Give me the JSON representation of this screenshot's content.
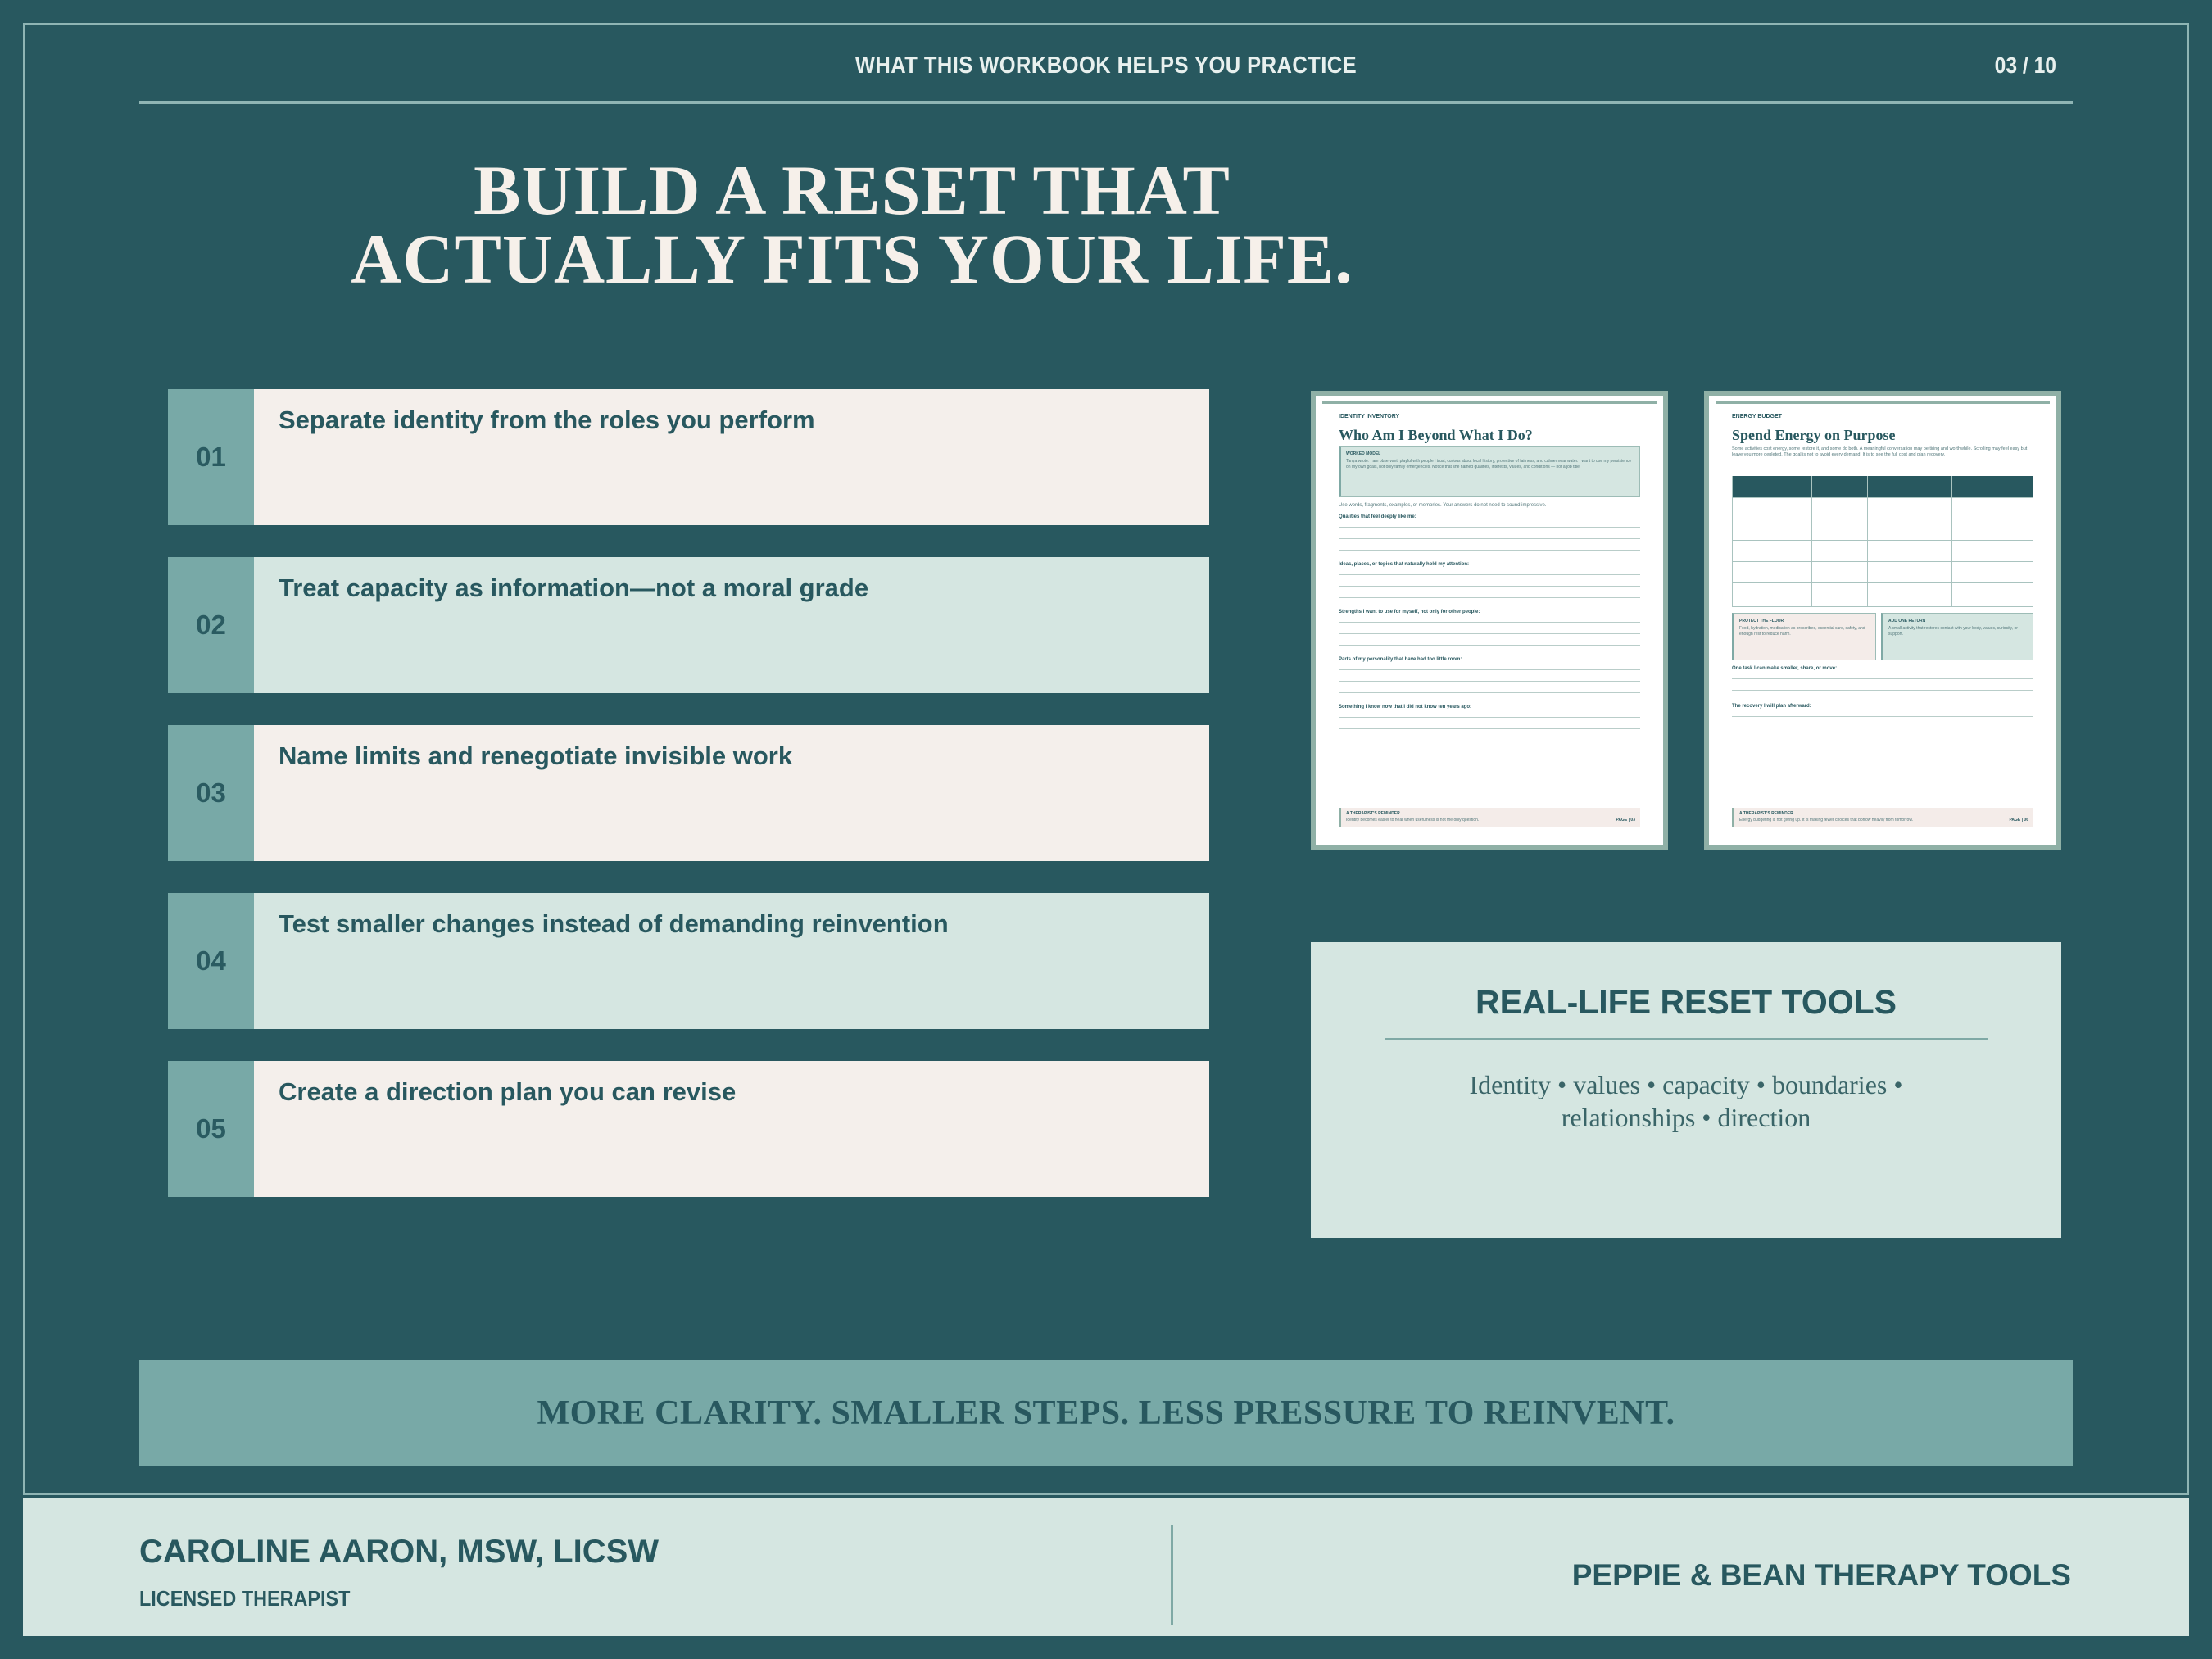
{
  "header": {
    "title": "WHAT THIS WORKBOOK HELPS YOU PRACTICE",
    "page": "03 / 10"
  },
  "headline": {
    "line1": "BUILD A RESET THAT",
    "line2": "ACTUALLY FITS YOUR LIFE."
  },
  "steps": [
    {
      "num": "01",
      "text": "Separate identity from the roles you perform"
    },
    {
      "num": "02",
      "text": "Treat capacity as information—not a moral grade"
    },
    {
      "num": "03",
      "text": "Name limits and renegotiate invisible work"
    },
    {
      "num": "04",
      "text": "Test smaller changes instead of demanding reinvention"
    },
    {
      "num": "05",
      "text": "Create a direction plan you can revise"
    }
  ],
  "previews": [
    {
      "kicker": "IDENTITY INVENTORY",
      "title": "Who Am I Beyond What I Do?",
      "box_label": "WORKED MODEL",
      "box_text": "Tanya wrote: I am observant, playful with people I trust, curious about local history, protective of fairness, and calmer near water. I want to use my persistence on my own goals, not only family emergencies. Notice that she named qualities, interests, values, and conditions — not a job title.",
      "intro": "Use words, fragments, examples, or memories. Your answers do not need to sound impressive.",
      "prompts": [
        "Qualities that feel deeply like me:",
        "Ideas, places, or topics that naturally hold my attention:",
        "Strengths I want to use for myself, not only for other people:",
        "Parts of my personality that have had too little room:",
        "Something I know now that I did not know ten years ago:"
      ],
      "footer_label": "A THERAPIST'S REMINDER",
      "footer_text": "Identity becomes easier to hear when usefulness is not the only question.",
      "footer_page": "PAGE | 03"
    },
    {
      "kicker": "ENERGY BUDGET",
      "title": "Spend Energy on Purpose",
      "intro": "Some activities cost energy, some restore it, and some do both. A meaningful conversation may be tiring and worthwhile. Scrolling may feel easy but leave you more depleted. The goal is not to avoid every demand. It is to see the full cost and plan recovery.",
      "box1_label": "PROTECT THE FLOOR",
      "box1_text": "Food, hydration, medication as prescribed, essential care, safety, and enough rest to reduce harm.",
      "box2_label": "ADD ONE RETURN",
      "box2_text": "A small activity that restores contact with your body, values, curiosity, or support.",
      "prompts": [
        "One task I can make smaller, share, or move:",
        "The recovery I will plan afterward:"
      ],
      "footer_label": "A THERAPIST'S REMINDER",
      "footer_text": "Energy budgeting is not giving up. It is making fewer choices that borrow heavily from tomorrow.",
      "footer_page": "PAGE | 06"
    }
  ],
  "tools": {
    "title": "REAL-LIFE RESET TOOLS",
    "line1": "Identity • values • capacity • boundaries •",
    "line2": "relationships • direction"
  },
  "banner": "MORE CLARITY. SMALLER STEPS. LESS PRESSURE TO REINVENT.",
  "footer": {
    "author": "CAROLINE AARON, MSW, LICSW",
    "role": "LICENSED THERAPIST",
    "brand": "PEPPIE & BEAN THERAPY TOOLS"
  },
  "colors": {
    "background": "#28585f",
    "accent": "#78a9a7",
    "mint": "#d5e6e1",
    "cream": "#f4efeb"
  }
}
